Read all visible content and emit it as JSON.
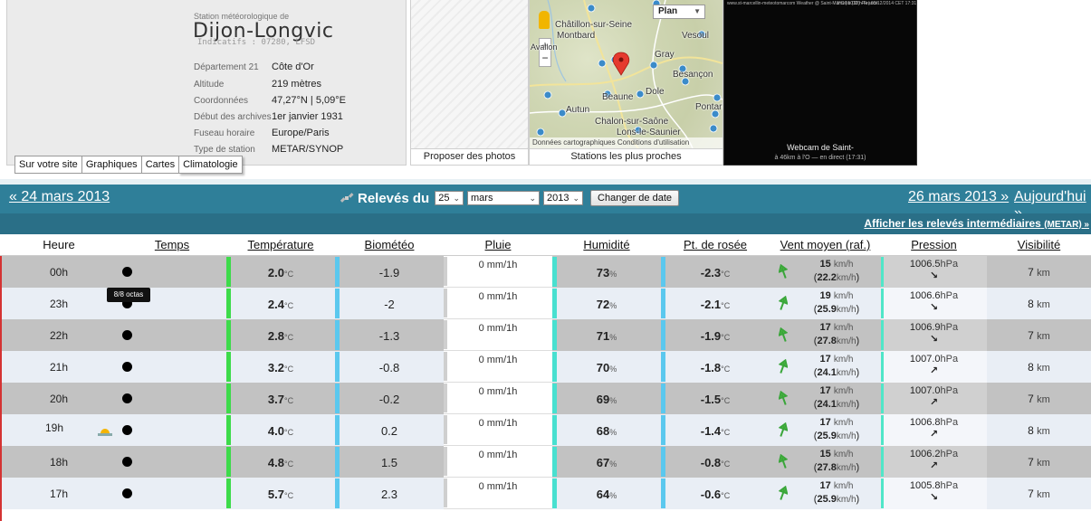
{
  "colors": {
    "nav_bg": "#2f7f99",
    "nav_sub_bg": "#2a6f87",
    "row_even_bg": "#e9eef5",
    "row_odd_bg": "#c2c2c2",
    "temp_bar": "#3ddb4a",
    "bio_bar": "#5bc8ee",
    "hum_bar": "#48e0d0",
    "dew_bar": "#5bc8ee"
  },
  "station": {
    "subtitle": "Station météorologique de",
    "name": "Dijon-Longvic",
    "indicatifs": "Indicatifs : 07280, LFSD",
    "info": [
      {
        "label": "Département 21",
        "value": "Côte d'Or"
      },
      {
        "label": "Altitude",
        "value": "219 mètres"
      },
      {
        "label": "Coordonnées",
        "value": "47,27°N | 5,09°E"
      },
      {
        "label": "Début des archives",
        "value": "1er janvier 1931"
      },
      {
        "label": "Fuseau horaire",
        "value": "Europe/Paris"
      },
      {
        "label": "Type de station",
        "value": "METAR/SYNOP"
      }
    ]
  },
  "tabs": [
    "Sur votre site",
    "Graphiques",
    "Cartes",
    "Climatologie"
  ],
  "photos": {
    "caption": "Proposer des photos"
  },
  "map": {
    "caption": "Stations les plus proches",
    "select": "Plan",
    "footer": "Données cartographiques   Conditions d'utilisation",
    "labels": [
      "Châtillon-sur-Seine",
      "Montbard",
      "Vesoul",
      "Gray",
      "Besançon",
      "Avallon",
      "Beaune",
      "Dole",
      "Autun",
      "Pontarlier",
      "Chalon-sur-Saône",
      "Lons-le-Saunier"
    ]
  },
  "webcam": {
    "top_text": "www.st-marcellin-meteotomarcom  Weather @ Saint-Marcellin (38) - France",
    "top_right": "3°C | 1012 hPa | 03/12/2014 CET 17:31",
    "caption": "Webcam de Saint-",
    "subcaption": "à 46km à l'O — en direct (17:31)"
  },
  "nav": {
    "prev": "« 24 mars 2013",
    "label": "Relevés du",
    "day": "25",
    "month": "mars",
    "year": "2013",
    "change_btn": "Changer de date",
    "next": "26 mars 2013 »",
    "today": "Aujourd'hui »",
    "intermediate": "Afficher les relevés intermédiaires",
    "intermediate_small": "(METAR) »"
  },
  "tooltip": "8/8 octas",
  "table": {
    "headers": [
      "Heure",
      "Temps",
      "Température",
      "Biométéo",
      "Pluie",
      "Humidité",
      "Pt. de rosée",
      "Vent moyen (raf.)",
      "Pression",
      "Visibilité"
    ],
    "rows": [
      {
        "hour": "00h",
        "temp": "2.0",
        "bio": "-1.9",
        "rain": "0 mm/1h",
        "hum": "73",
        "dew": "-2.3",
        "wind": "15",
        "gust": "22.2",
        "pres": "1006.5",
        "parrow": "↘",
        "vis": "7"
      },
      {
        "hour": "23h",
        "temp": "2.4",
        "bio": "-2",
        "rain": "0 mm/1h",
        "hum": "72",
        "dew": "-2.1",
        "wind": "19",
        "gust": "25.9",
        "pres": "1006.6",
        "parrow": "↘",
        "vis": "8"
      },
      {
        "hour": "22h",
        "temp": "2.8",
        "bio": "-1.3",
        "rain": "0 mm/1h",
        "hum": "71",
        "dew": "-1.9",
        "wind": "17",
        "gust": "27.8",
        "pres": "1006.9",
        "parrow": "↘",
        "vis": "7"
      },
      {
        "hour": "21h",
        "temp": "3.2",
        "bio": "-0.8",
        "rain": "0 mm/1h",
        "hum": "70",
        "dew": "-1.8",
        "wind": "17",
        "gust": "24.1",
        "pres": "1007.0",
        "parrow": "↗",
        "vis": "8"
      },
      {
        "hour": "20h",
        "temp": "3.7",
        "bio": "-0.2",
        "rain": "0 mm/1h",
        "hum": "69",
        "dew": "-1.5",
        "wind": "17",
        "gust": "24.1",
        "pres": "1007.0",
        "parrow": "↗",
        "vis": "7"
      },
      {
        "hour": "19h",
        "temp": "4.0",
        "bio": "0.2",
        "rain": "0 mm/1h",
        "hum": "68",
        "dew": "-1.4",
        "wind": "17",
        "gust": "25.9",
        "pres": "1006.8",
        "parrow": "↗",
        "vis": "8"
      },
      {
        "hour": "18h",
        "temp": "4.8",
        "bio": "1.5",
        "rain": "0 mm/1h",
        "hum": "67",
        "dew": "-0.8",
        "wind": "15",
        "gust": "27.8",
        "pres": "1006.2",
        "parrow": "↗",
        "vis": "7"
      },
      {
        "hour": "17h",
        "temp": "5.7",
        "bio": "2.3",
        "rain": "0 mm/1h",
        "hum": "64",
        "dew": "-0.6",
        "wind": "17",
        "gust": "25.9",
        "pres": "1005.8",
        "parrow": "↘",
        "vis": "7"
      }
    ],
    "units": {
      "temp": "°C",
      "hum": "%",
      "dew": "°C",
      "wind": "km/h",
      "pres": "hPa",
      "vis": "km"
    }
  }
}
